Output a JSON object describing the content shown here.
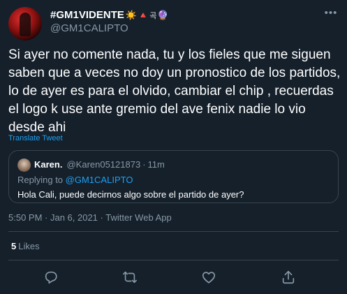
{
  "tweet": {
    "display_name": "#GM1VIDENTE",
    "name_emojis": {
      "sun": "☀️",
      "triangle": "🔺",
      "hangul": "곡",
      "orb": "🔮"
    },
    "handle": "@GM1CALIPTO",
    "more_icon": "more-horizontal-icon",
    "text": "Si ayer no comente nada, tu y los fieles que me siguen saben que a veces no doy un pronostico de los partidos, lo de ayer es para el olvido, cambiar el chip , recuerdas el logo k use ante gremio del ave fenix nadie lo vio desde ahi",
    "translate_label": "Translate Tweet",
    "timestamp": "5:50 PM · Jan 6, 2021",
    "source_separator": "·",
    "source": "Twitter Web App",
    "likes_count": "5",
    "likes_label": "Likes"
  },
  "quoted": {
    "display_name": "Karen.",
    "handle": "@Karen05121873",
    "separator": "·",
    "time": "11m",
    "replying_prefix": "Replying to",
    "replying_to": "@GM1CALIPTO",
    "text": "Hola Cali, puede decirnos algo sobre el partido de ayer?"
  },
  "actions": [
    {
      "icon": "reply-icon"
    },
    {
      "icon": "retweet-icon"
    },
    {
      "icon": "like-icon"
    },
    {
      "icon": "share-icon"
    }
  ],
  "colors": {
    "background": "#15202b",
    "text": "#ffffff",
    "secondary": "#8899a6",
    "accent": "#1da1f2",
    "border": "#38444d"
  }
}
